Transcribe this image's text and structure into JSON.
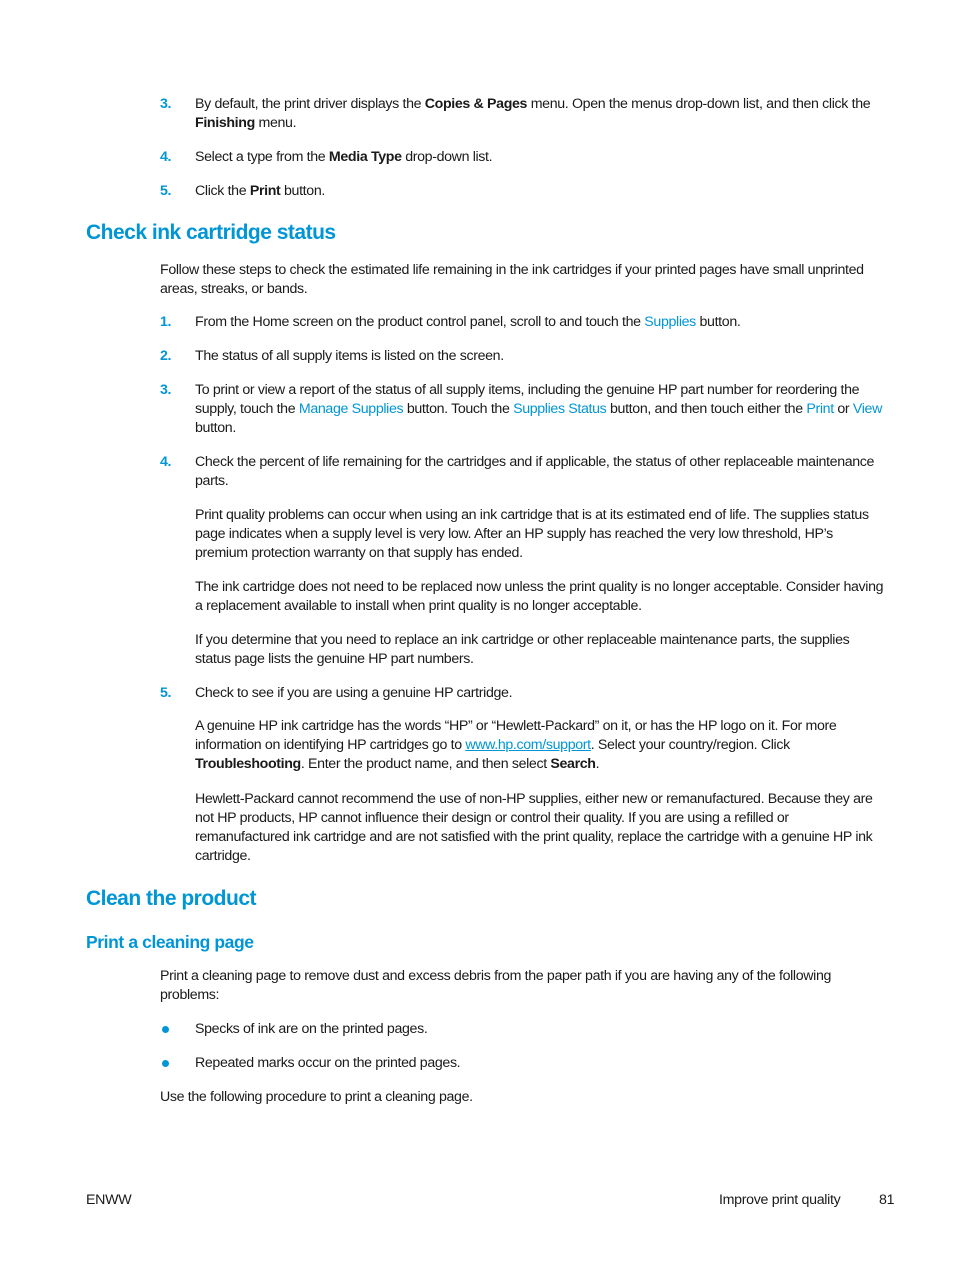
{
  "top_steps": [
    {
      "num": "3.",
      "t1": "By default, the print driver displays the ",
      "b1": "Copies & Pages",
      "t2": " menu. Open the menus drop-down list, and then click the ",
      "b2": "Finishing",
      "t3": " menu."
    },
    {
      "num": "4.",
      "t1": "Select a type from the ",
      "b1": "Media Type",
      "t2": " drop-down list."
    },
    {
      "num": "5.",
      "t1": "Click the ",
      "b1": "Print",
      "t2": " button."
    }
  ],
  "section_ink": {
    "heading": "Check ink cartridge status",
    "intro": "Follow these steps to check the estimated life remaining in the ink cartridges if your printed pages have small unprinted areas, streaks, or bands.",
    "steps": [
      {
        "num": "1.",
        "t1": "From the Home screen on the product control panel, scroll to and touch the ",
        "l1": "Supplies",
        "t2": " button."
      },
      {
        "num": "2.",
        "t1": "The status of all supply items is listed on the screen."
      },
      {
        "num": "3.",
        "t1": "To print or view a report of the status of all supply items, including the genuine HP part number for reordering the supply, touch the ",
        "l1": "Manage Supplies",
        "t2": " button. Touch the ",
        "l2": "Supplies Status",
        "t3": " button, and then touch either the ",
        "l3": "Print",
        "t4": " or ",
        "l4": "View",
        "t5": " button."
      },
      {
        "num": "4.",
        "t1": "Check the percent of life remaining for the cartridges and if applicable, the status of other replaceable maintenance parts.",
        "paras": [
          "Print quality problems can occur when using an ink cartridge that is at its estimated end of life. The supplies status page indicates when a supply level is very low. After an HP supply has reached the very low threshold, HP’s premium protection warranty on that supply has ended.",
          "The ink cartridge does not need to be replaced now unless the print quality is no longer acceptable. Consider having a replacement available to install when print quality is no longer acceptable.",
          "If you determine that you need to replace an ink cartridge or other replaceable maintenance parts, the supplies status page lists the genuine HP part numbers."
        ]
      },
      {
        "num": "5.",
        "t1": "Check to see if you are using a genuine HP cartridge.",
        "p1_a": "A genuine HP ink cartridge has the words “HP” or “Hewlett-Packard” on it, or has the HP logo on it. For more information on identifying HP cartridges go to ",
        "p1_link": "www.hp.com/support",
        "p1_b": ". Select your country/region. Click ",
        "p1_bold1": "Troubleshooting",
        "p1_c": ". Enter the product name, and then select ",
        "p1_bold2": "Search",
        "p1_d": ".",
        "p2": "Hewlett-Packard cannot recommend the use of non-HP supplies, either new or remanufactured. Because they are not HP products, HP cannot influence their design or control their quality. If you are using a refilled or remanufactured ink cartridge and are not satisfied with the print quality, replace the cartridge with a genuine HP ink cartridge."
      }
    ]
  },
  "section_clean": {
    "heading": "Clean the product",
    "subheading": "Print a cleaning page",
    "intro": "Print a cleaning page to remove dust and excess debris from the paper path if you are having any of the following problems:",
    "bullets": [
      "Specks of ink are on the printed pages.",
      "Repeated marks occur on the printed pages."
    ],
    "outro": "Use the following procedure to print a cleaning page."
  },
  "footer": {
    "left": "ENWW",
    "section": "Improve print quality",
    "page_number": "81"
  },
  "colors": {
    "accent": "#0096d6",
    "text": "#1a1a1a"
  }
}
